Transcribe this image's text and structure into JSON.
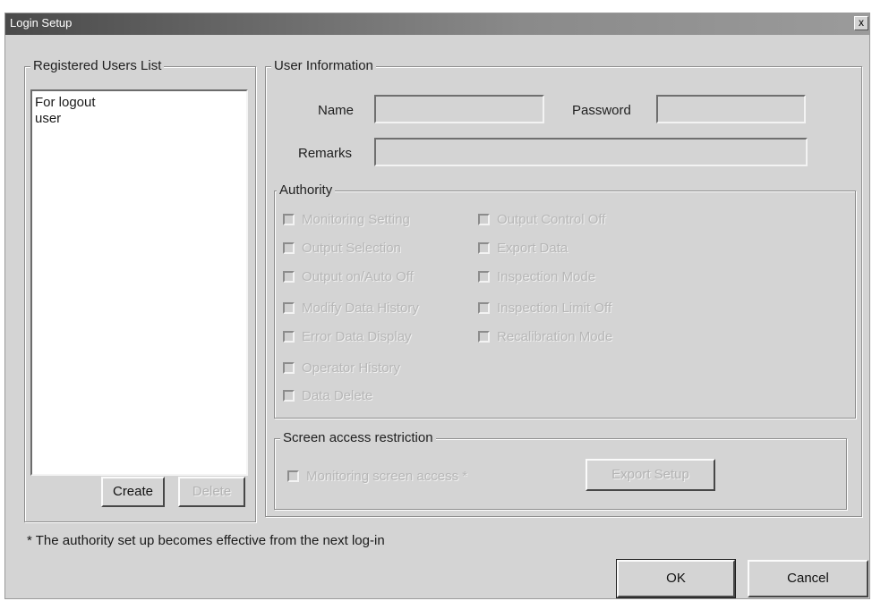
{
  "window": {
    "title": "Login Setup",
    "close_glyph": "x"
  },
  "users_group": {
    "legend": "Registered Users List",
    "items": [
      "For logout",
      "user"
    ],
    "create_label": "Create",
    "delete_label": "Delete"
  },
  "info_group": {
    "legend": "User Information",
    "name_label": "Name",
    "password_label": "Password",
    "remarks_label": "Remarks",
    "name_value": "",
    "password_value": "",
    "remarks_value": ""
  },
  "authority_group": {
    "legend": "Authority",
    "left_items": [
      "Monitoring Setting",
      "Output Selection",
      "Output on/Auto Off",
      "Modify Data History",
      "Error Data Display"
    ],
    "right_items": [
      "Output Control Off",
      "Export Data",
      "Inspection Mode",
      "Inspection Limit Off",
      "Recalibration Mode"
    ],
    "extra_items": [
      "Operator History",
      "Data Delete"
    ]
  },
  "screen_group": {
    "legend": "Screen access restriction",
    "checkbox_label": "Monitoring screen access *",
    "button_label": "Export Setup"
  },
  "footer": {
    "note": "* The authority set up becomes effective from the next log-in",
    "ok_label": "OK",
    "cancel_label": "Cancel"
  },
  "colors": {
    "dialog_bg": "#d4d4d4",
    "title_bar": "#4a4a4a",
    "disabled_text": "#b7b7b7"
  }
}
